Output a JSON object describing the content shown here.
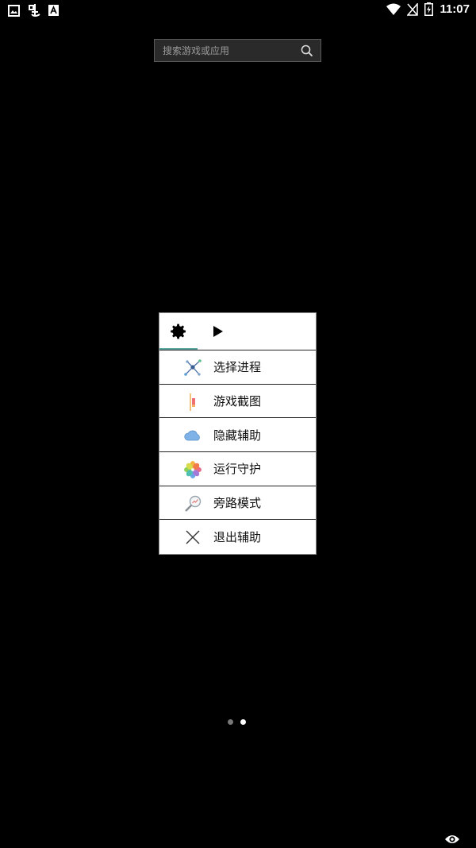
{
  "status_bar": {
    "time": "11:07",
    "left_icons": [
      "image-icon",
      "bug-icon",
      "a-box-icon"
    ],
    "right_icons": [
      "wifi-icon",
      "no-sim-icon",
      "battery-charging-icon"
    ]
  },
  "search": {
    "placeholder": "搜索游戏或应用",
    "icon": "search-icon"
  },
  "menu": {
    "tabs": [
      {
        "icon": "gear-icon",
        "selected": true
      },
      {
        "icon": "play-icon",
        "selected": false
      }
    ],
    "items": [
      {
        "label": "选择进程",
        "icon": "process-network-icon"
      },
      {
        "label": "游戏截图",
        "icon": "screenshot-icon"
      },
      {
        "label": "隐藏辅助",
        "icon": "cloud-icon"
      },
      {
        "label": "运行守护",
        "icon": "flower-icon"
      },
      {
        "label": "旁路模式",
        "icon": "magnifier-chart-icon"
      },
      {
        "label": "退出辅助",
        "icon": "close-icon"
      }
    ],
    "accent_color": "#5fa7a3"
  },
  "pager": {
    "pages": 2,
    "current": 2
  }
}
